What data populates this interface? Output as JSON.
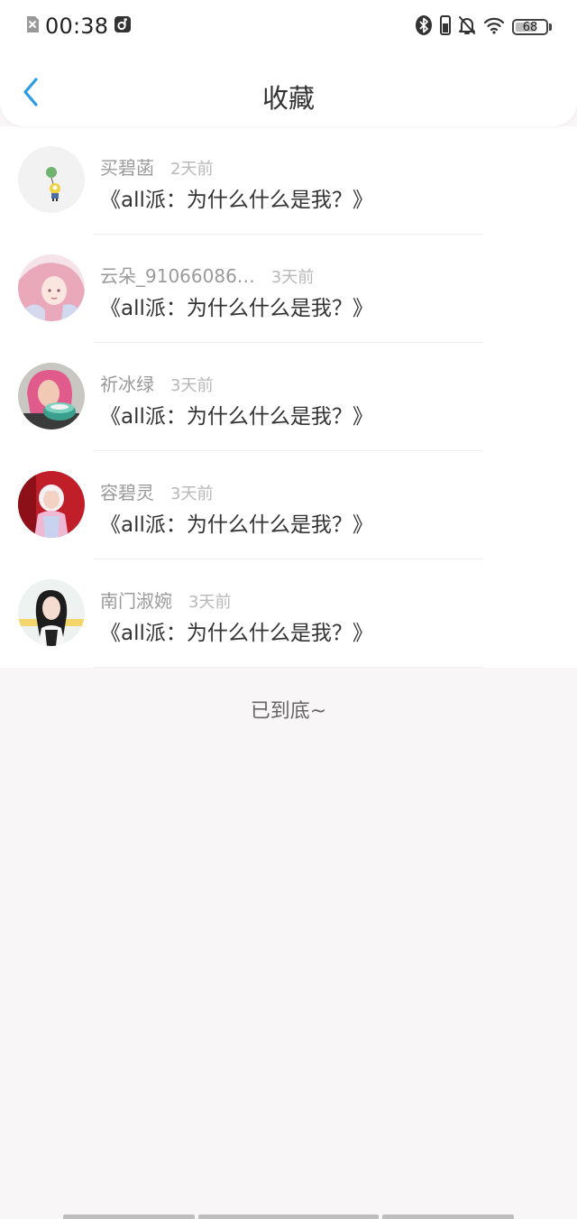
{
  "status_bar": {
    "time": "00:38",
    "battery": "68",
    "battery_level": 0.68,
    "icons": [
      "sim-off-icon",
      "app-notification-icon",
      "bluetooth-icon",
      "vibrate-icon",
      "bell-off-icon",
      "wifi-icon",
      "battery-icon"
    ]
  },
  "header": {
    "title": "收藏",
    "back_icon": "chevron-left-icon",
    "accent_color": "#2b9be8"
  },
  "items": [
    {
      "username": "买碧菡",
      "time": "2天前",
      "title": "《all派：为什么什么是我？》"
    },
    {
      "username": "云朵_91066086…",
      "time": "3天前",
      "title": "《all派：为什么什么是我？》"
    },
    {
      "username": "祈冰绿",
      "time": "3天前",
      "title": "《all派：为什么什么是我？》"
    },
    {
      "username": "容碧灵",
      "time": "3天前",
      "title": "《all派：为什么什么是我？》"
    },
    {
      "username": "南门淑婉",
      "time": "3天前",
      "title": "《all派：为什么什么是我？》"
    }
  ],
  "footer": {
    "end_text": "已到底~"
  }
}
